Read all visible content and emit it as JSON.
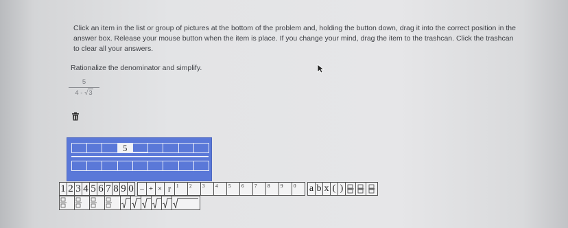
{
  "instructions": "Click an item in the list or group of pictures at the bottom of the problem and, holding the button down, drag it into the correct position in the answer box. Release your mouse button when the item is place. If you change your mind, drag the item to the trashcan. Click the trashcan to clear all your answers.",
  "prompt": "Rationalize the denominator and simplify.",
  "expression": {
    "numerator": "5",
    "denominator_prefix": "4 - ",
    "radicand": "3",
    "radical_symbol": "√"
  },
  "answer_box": {
    "filled_value": "5"
  },
  "palette": {
    "digits": [
      "1",
      "2",
      "3",
      "4",
      "5",
      "6",
      "7",
      "8",
      "9",
      "0"
    ],
    "operators": [
      "–",
      "+",
      "×"
    ],
    "power_label": "r",
    "superscripts": [
      "1",
      "2",
      "3",
      "4",
      "5",
      "6",
      "7",
      "8",
      "9",
      "0"
    ],
    "variables": [
      "a",
      "b",
      "x"
    ],
    "parens": [
      "(",
      ")"
    ]
  },
  "colors": {
    "answer_box": "#5a78d8",
    "tile_bg": "#f3f3f4"
  },
  "icons": {
    "trash": "trash-icon",
    "cursor": "pointer-cursor-icon"
  }
}
